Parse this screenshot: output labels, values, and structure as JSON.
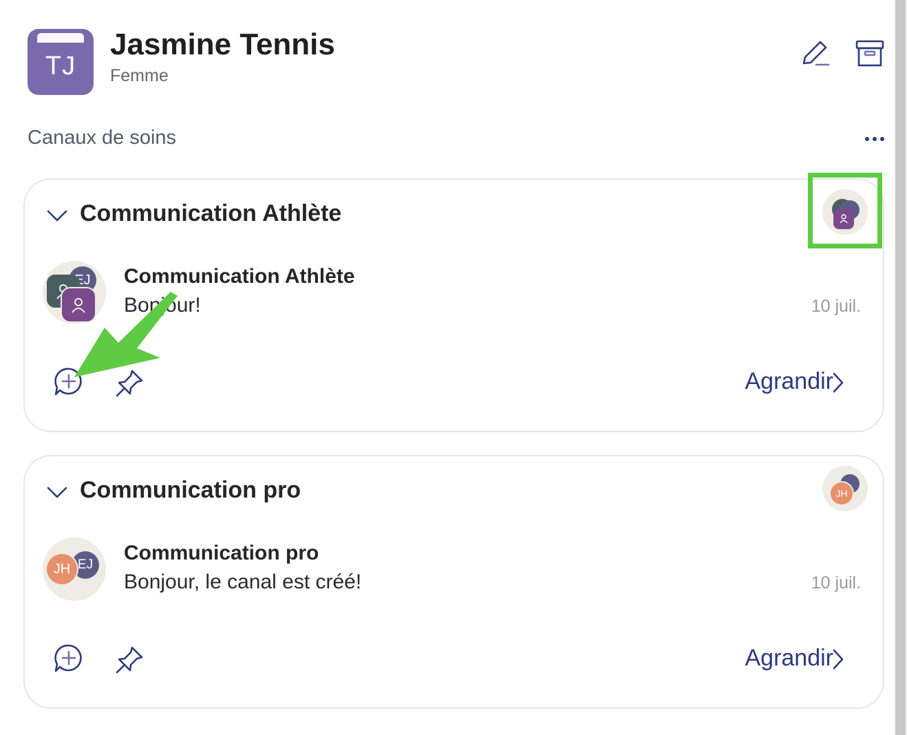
{
  "patient": {
    "initials": "TJ",
    "name": "Jasmine Tennis",
    "gender": "Femme",
    "avatar_color": "#7a6aad"
  },
  "header_icons": {
    "edit": "edit-pencil-icon",
    "archive": "archive-box-icon"
  },
  "section": {
    "title": "Canaux de soins",
    "more": "more-options-icon"
  },
  "channels": [
    {
      "title": "Communication Athlète",
      "last_message_title": "Communication Athlète",
      "last_message": "Bonjour!",
      "date": "10 juil.",
      "avatar_initials": "EJ",
      "expand_label": "Agrandir"
    },
    {
      "title": "Communication pro",
      "last_message_title": "Communication pro",
      "last_message": "Bonjour, le canal est créé!",
      "date": "10 juil.",
      "avatar_initials_front": "JH",
      "avatar_initials_back": "EJ",
      "expand_label": "Agrandir"
    }
  ],
  "colors": {
    "accent": "#2d3a7a",
    "highlight": "#5fcb44",
    "purple": "#7a4a8c",
    "teal": "#4a5e60",
    "orange": "#e8906a",
    "slate": "#5a5c86"
  }
}
